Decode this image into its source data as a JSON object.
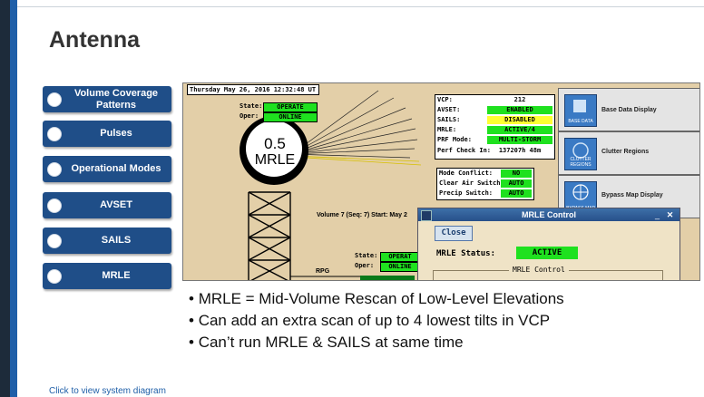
{
  "slide": {
    "title": "Antenna",
    "footer_link": "Click to view system diagram"
  },
  "nav_buttons": [
    {
      "label": "Volume Coverage Patterns"
    },
    {
      "label": "Pulses"
    },
    {
      "label": "Operational Modes"
    },
    {
      "label": "AVSET"
    },
    {
      "label": "SAILS"
    },
    {
      "label": "MRLE"
    }
  ],
  "screenshot": {
    "datetime": "Thursday May 26, 2016  12:32:48 UT",
    "state_label": "State:",
    "state_value": "OPERATE",
    "oper_label": "Oper:",
    "oper_value": "ONLINE",
    "elev_value": "0.5",
    "elev_mode": "MRLE",
    "status_rows": [
      {
        "key": "VCP:",
        "value": "212",
        "color": "white"
      },
      {
        "key": "AVSET:",
        "value": "ENABLED",
        "color": "green"
      },
      {
        "key": "SAILS:",
        "value": "DISABLED",
        "color": "yellow"
      },
      {
        "key": "MRLE:",
        "value": "ACTIVE/4",
        "color": "green"
      },
      {
        "key": "PRF Mode:",
        "value": "MULTI-STORM",
        "color": "green"
      },
      {
        "key": "Perf Check In:",
        "value": "137207h 48m",
        "color": "white"
      }
    ],
    "switch_rows": [
      {
        "key": "Mode Conflict:",
        "value": "NO"
      },
      {
        "key": "Clear Air Switch:",
        "value": "AUTO"
      },
      {
        "key": "Precip Switch:",
        "value": "AUTO"
      }
    ],
    "volume_text": "Volume 7 (Seq: 7) Start: May 2",
    "state2_label": "State:",
    "state2_value": "OPERAT",
    "oper2_label": "Oper:",
    "oper2_value": "ONLINE",
    "rpg_label": "RPG",
    "right_panels": [
      {
        "label": "Base Data Display",
        "icon": "base-data-icon",
        "icon_text": "BASE DATA"
      },
      {
        "label": "Clutter Regions",
        "icon": "clutter-icon",
        "icon_text": "CLUTTER REGIONS"
      },
      {
        "label": "Bypass Map Display",
        "icon": "bypass-map-icon",
        "icon_text": "BYPASS MAP"
      }
    ],
    "dialog": {
      "title": "MRLE Control",
      "close_label": "Close",
      "status_label": "MRLE Status:",
      "status_value": "ACTIVE",
      "group_label": "MRLE Control"
    }
  },
  "bullets": [
    "MRLE = Mid-Volume Rescan of Low-Level Elevations",
    "Can add an extra scan of up to 4 lowest tilts in VCP",
    "Can’t run MRLE & SAILS at same time"
  ],
  "colors": {
    "nav_button_bg": "#1f4e88",
    "status_green": "#1fe11f",
    "status_yellow": "#ffff33",
    "screenshot_bg": "#e3cfa8"
  }
}
